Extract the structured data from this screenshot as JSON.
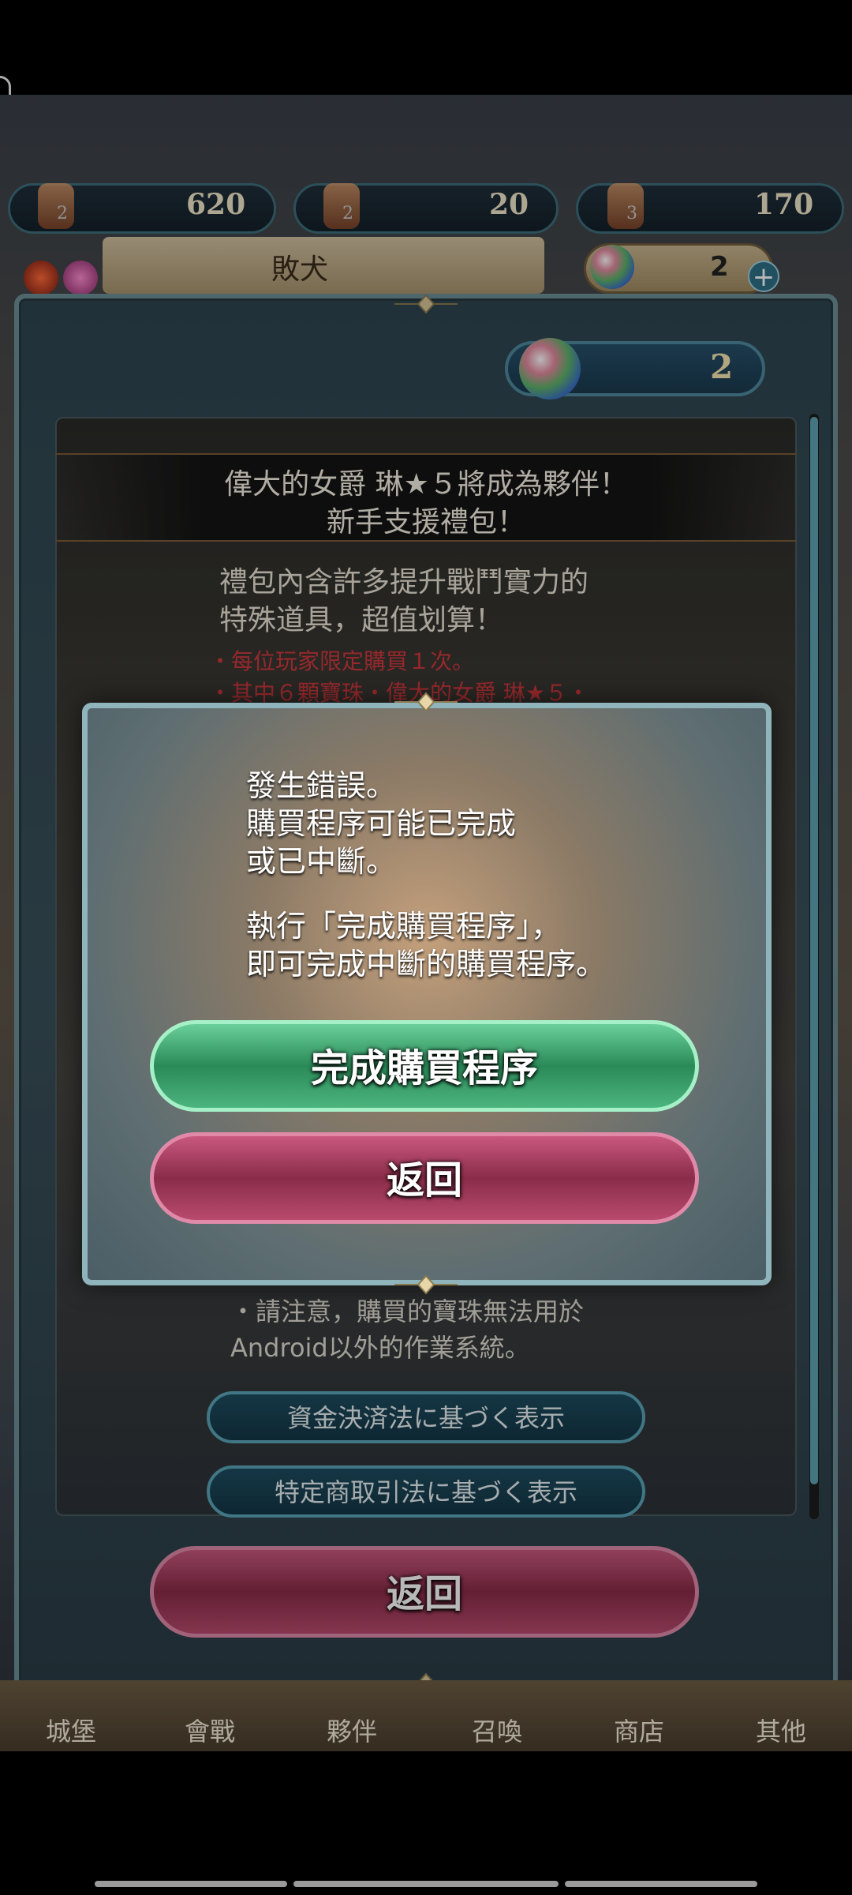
{
  "resources": [
    {
      "count": "2",
      "value": "620"
    },
    {
      "count": "2",
      "value": "20"
    },
    {
      "count": "3",
      "value": "170"
    }
  ],
  "header": {
    "name": "敗犬",
    "orb_count": "2",
    "plus_icon": "plus-icon"
  },
  "panel": {
    "orb_count": "2",
    "title_line1": "偉大的女爵 琳★５將成為夥伴！",
    "title_line2": "新手支援禮包！",
    "desc_line1": "禮包內含許多提升戰鬥實力的",
    "desc_line2": "特殊道具，超值划算！",
    "red_note_line1": "・每位玩家限定購買１次。",
    "red_note_line2": "・其中６顆寶珠・偉大的女爵 琳★５・",
    "note_line1": "・請注意，購買的寶珠無法用於",
    "note_line2": "Android以外的作業系統。",
    "legal_button_1": "資金決済法に基づく表示",
    "legal_button_2": "特定商取引法に基づく表示",
    "back_button": "返回"
  },
  "bottom_nav": [
    "城堡",
    "會戰",
    "夥伴",
    "召喚",
    "商店",
    "其他"
  ],
  "dialog": {
    "message_line1": "發生錯誤。",
    "message_line2": "購買程序可能已完成",
    "message_line3": "或已中斷。",
    "message_line4": "執行「完成購買程序」，",
    "message_line5": "即可完成中斷的購買程序。",
    "complete_button": "完成購買程序",
    "back_button": "返回"
  },
  "colors": {
    "green_button": "#2a8a58",
    "red_button": "#8a2c4a",
    "panel_border": "#6c8f98",
    "red_note": "#d0383e"
  }
}
